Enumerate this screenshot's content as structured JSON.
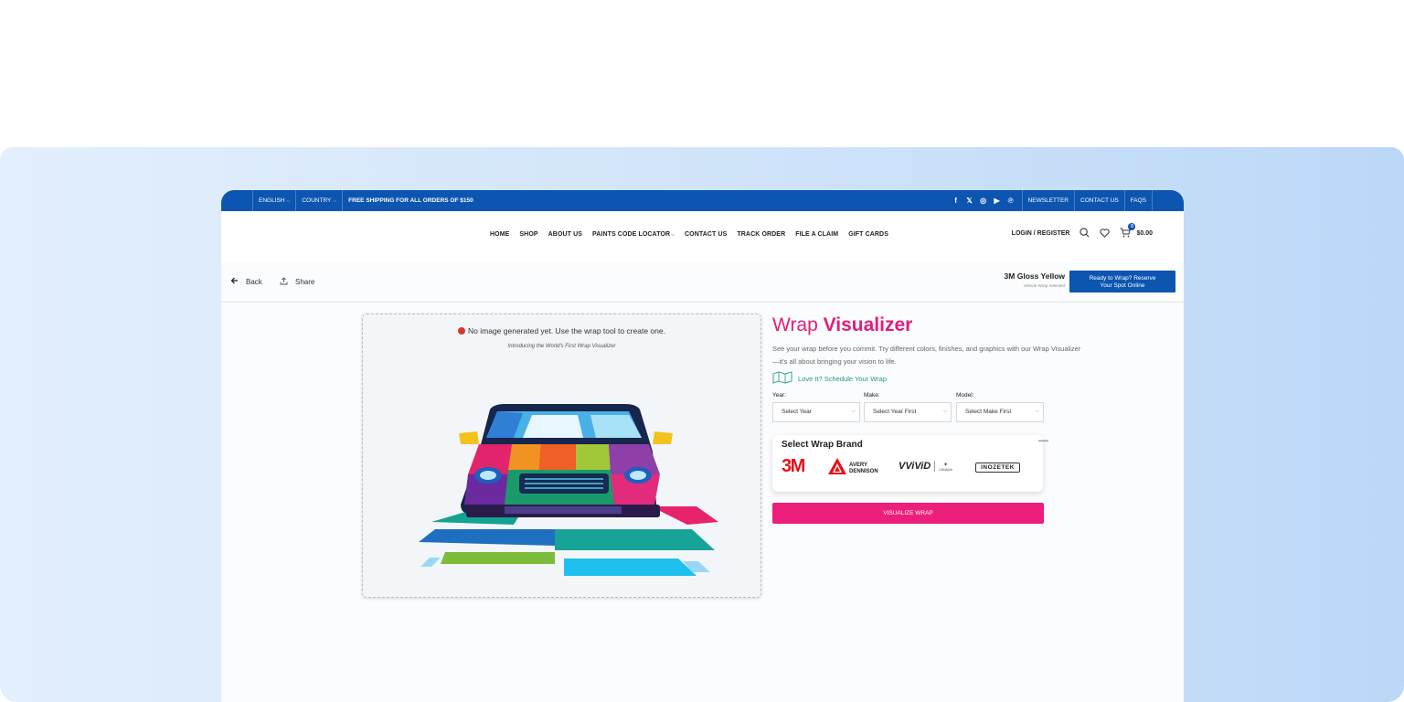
{
  "topbar": {
    "language": "ENGLISH",
    "country": "COUNTRY",
    "shipping": "FREE SHIPPING FOR ALL ORDERS OF $150",
    "social_icons": [
      "facebook-icon",
      "x-icon",
      "instagram-icon",
      "youtube-icon",
      "pinterest-icon"
    ],
    "links": [
      "NEWSLETTER",
      "CONTACT US",
      "FAQS"
    ]
  },
  "nav": {
    "items": [
      "HOME",
      "SHOP",
      "ABOUT US",
      "PAINTS CODE LOCATOR",
      "CONTACT US",
      "TRACK ORDER",
      "FILE A CLAIM",
      "GIFT CARDS"
    ],
    "login": "LOGIN / REGISTER",
    "cart_count": "0",
    "cart_total": "$0.00"
  },
  "actions": {
    "back": "Back",
    "share": "Share",
    "selected_name": "3M Gloss Yellow",
    "selected_sub": "Vehicle Wrap Selected",
    "reserve_line1": "Ready to Wrap? Reserve",
    "reserve_line2": "Your Spot Online"
  },
  "preview": {
    "message": "No image generated yet. Use the wrap tool to create one.",
    "intro": "Introducing the World's First Wrap Visualizer"
  },
  "visualizer": {
    "title_light": "Wrap ",
    "title_bold": "Visualizer",
    "description": "See your wrap before you commit. Try different colors, finishes, and graphics with our Wrap Visualizer—it's all about bringing your vision to life.",
    "schedule_link": "Love It? Schedule Your Wrap",
    "year_label": "Year:",
    "year_value": "Select Year",
    "make_label": "Make:",
    "make_value": "Select Year First",
    "model_label": "Model:",
    "model_value": "Select Make First",
    "brand_title": "Select Wrap Brand",
    "brands": {
      "b3m": "3M",
      "avery_1": "AVERY",
      "avery_2": "DENNISON",
      "vvivid": "VViViD",
      "vvivid_country": "CANADA",
      "inozetek": "INOZETEK"
    },
    "button": "VISUALIZE WRAP"
  },
  "colors": {
    "brand_blue": "#0c55b0",
    "accent_pink": "#ec1f7c",
    "teal_link": "#1c9c8c"
  }
}
